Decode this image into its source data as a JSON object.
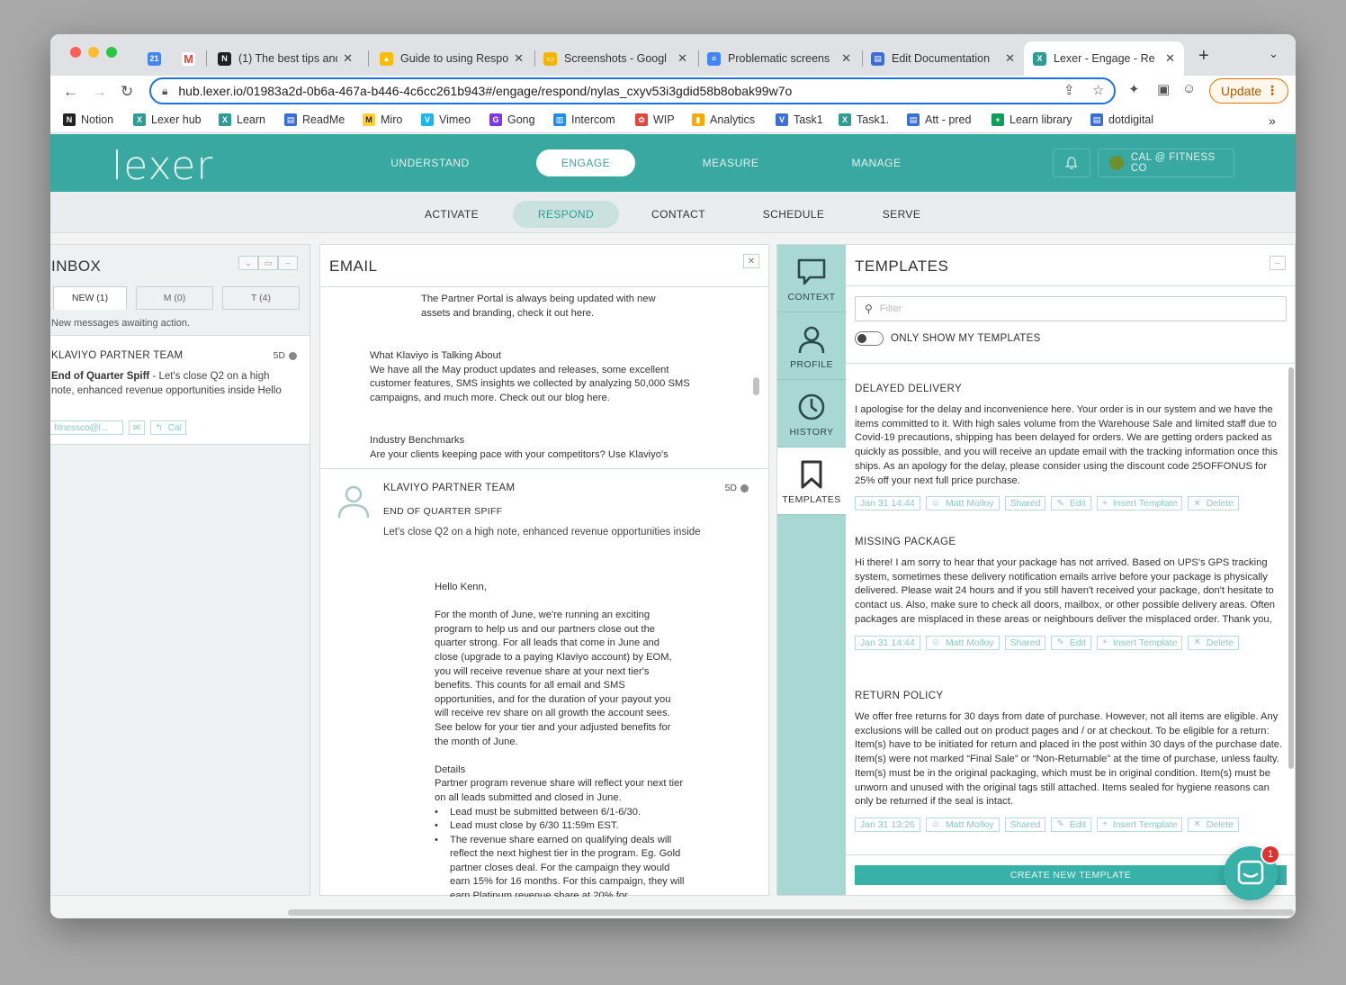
{
  "browser": {
    "tabs": [
      {
        "title": "",
        "icon": "calendar-icon",
        "color": "#4285f4"
      },
      {
        "title": "",
        "icon": "gmail-icon",
        "color": "#ea4335"
      },
      {
        "title": "(1) The best tips and",
        "icon": "notion-icon",
        "color": "#222222"
      },
      {
        "title": "Guide to using Respo",
        "icon": "drive-icon",
        "color": "#fbbc04"
      },
      {
        "title": "Screenshots - Googl",
        "icon": "slides-icon",
        "color": "#f4b400"
      },
      {
        "title": "Problematic screens",
        "icon": "docs-icon",
        "color": "#4285f4"
      },
      {
        "title": "Edit Documentation",
        "icon": "readme-icon",
        "color": "#3b6fd4"
      },
      {
        "title": "Lexer - Engage - Re",
        "icon": "lexer-icon",
        "color": "#2d9c94"
      }
    ],
    "url": "hub.lexer.io/01983a2d-0b6a-467a-b446-4c6cc261b943#/engage/respond/nylas_cxyv53i3gdid58b8obak99w7o",
    "update_label": "Update",
    "bookmarks": [
      {
        "label": "Notion",
        "color": "#222222"
      },
      {
        "label": "Lexer hub",
        "color": "#2d9c94"
      },
      {
        "label": "Learn",
        "color": "#2d9c94"
      },
      {
        "label": "ReadMe",
        "color": "#3b6fd4"
      },
      {
        "label": "Miro",
        "color": "#ffd02f"
      },
      {
        "label": "Vimeo",
        "color": "#1ab7ea"
      },
      {
        "label": "Gong",
        "color": "#8039df"
      },
      {
        "label": "Intercom",
        "color": "#1f8ded"
      },
      {
        "label": "WIP",
        "color": "#e0493f"
      },
      {
        "label": "Analytics",
        "color": "#f9ab00"
      },
      {
        "label": "Task1",
        "color": "#3b6fd4"
      },
      {
        "label": "Task1.",
        "color": "#2d9c94"
      },
      {
        "label": "Att - pred",
        "color": "#3b6fd4"
      },
      {
        "label": "Learn library",
        "color": "#0f9d58"
      },
      {
        "label": "dotdigital",
        "color": "#3b6fd4"
      }
    ]
  },
  "app": {
    "logo": "lexer",
    "nav": [
      "UNDERSTAND",
      "ENGAGE",
      "MEASURE",
      "MANAGE"
    ],
    "account": "CAL @ FITNESS CO",
    "subnav": [
      "ACTIVATE",
      "RESPOND",
      "CONTACT",
      "SCHEDULE",
      "SERVE"
    ]
  },
  "inbox": {
    "title": "INBOX",
    "tabs": [
      "NEW (1)",
      "M (0)",
      "T (4)"
    ],
    "note": "New messages awaiting action.",
    "item": {
      "sender": "KLAVIYO PARTNER TEAM",
      "age": "5D",
      "subject": "End of Quarter Spiff",
      "preview": " - Let's close Q2 on a high note, enhanced revenue opportunities inside Hello",
      "chips": [
        "fitnessco@l...",
        "",
        "Cal"
      ]
    }
  },
  "email": {
    "title": "EMAIL",
    "top_blocks": [
      "The Partner Portal is always being updated with new assets and branding, check it out here.",
      "What Klaviyo is Talking About\nWe have all the May product updates and releases, some excellent customer features, SMS insights we collected by analyzing 50,000 SMS campaigns, and much more. Check out our blog here.",
      "Industry Benchmarks\nAre your clients keeping pace with your competitors? Use Klaviyo's"
    ],
    "message": {
      "from": "KLAVIYO PARTNER TEAM",
      "age": "5D",
      "subject": "END OF QUARTER SPIFF",
      "snippet": "Let's close Q2 on a high note, enhanced revenue opportunities inside",
      "greeting": "Hello Kenn,",
      "para1": "For the month of June, we're running an exciting program to help us and our partners close out the quarter strong. For all leads that come in June and close (upgrade to a paying Klaviyo account) by EOM, you will receive revenue share at your next tier's benefits. This counts for all email and SMS opportunities, and for the duration of your payout you will receive rev share on all growth the account sees. See below for your tier and your adjusted benefits for the month of June.",
      "details_heading": "Details",
      "details_intro": "Partner program revenue share will reflect your next tier on all leads submitted and closed in June.",
      "bullets": [
        "Lead must be submitted between 6/1-6/30.",
        "Lead must close by 6/30 11:59m EST.",
        "The revenue share earned on qualifying deals will reflect the next highest tier in the program. Eg. Gold partner closes deal. For the campaign they would earn 15% for 16 months. For this campaign, they will earn Platinum revenue share at 20% for"
      ]
    }
  },
  "sidebar": {
    "items": [
      {
        "label": "CONTEXT",
        "icon": "chat-bubble-icon"
      },
      {
        "label": "PROFILE",
        "icon": "person-icon"
      },
      {
        "label": "HISTORY",
        "icon": "clock-icon"
      },
      {
        "label": "TEMPLATES",
        "icon": "bookmark-icon"
      }
    ]
  },
  "templates": {
    "title": "TEMPLATES",
    "filter_placeholder": "Filter",
    "toggle_label": "ONLY SHOW MY TEMPLATES",
    "items": [
      {
        "name": "DELAYED DELIVERY",
        "body": "I apologise for the delay and inconvenience here. Your order is in our system and we have the items committed to it. With high sales volume from the Warehouse Sale and limited staff due to Covid-19 precautions, shipping has been delayed for orders. We are getting orders packed as quickly as possible, and you will receive an update email with the tracking information once this ships. As an apology for the delay, please consider using the discount code 25OFFONUS for 25% off your next full price purchase.",
        "date": "Jan 31 14:44",
        "author": "Matt Molloy",
        "shared": "Shared"
      },
      {
        "name": "MISSING PACKAGE",
        "body": "Hi there! I am sorry to hear that your package has not arrived. Based on UPS's GPS tracking system, sometimes these delivery notification emails arrive before your package is physically delivered. Please wait 24 hours and if you still haven't received your package, don't hesitate to contact us. Also, make sure to check all doors, mailbox, or other possible delivery areas. Often packages are misplaced in these areas or neighbours deliver the misplaced order. Thank you,",
        "date": "Jan 31 14:44",
        "author": "Matt Molloy",
        "shared": "Shared"
      },
      {
        "name": "RETURN POLICY",
        "body": "We offer free returns for 30 days from date of purchase. However, not all items are eligible. Any exclusions will be called out on product pages and / or at checkout. To be eligible for a return: Item(s) have to be initiated for return and placed in the post within 30 days of the purchase date. Item(s) were not marked “Final Sale” or “Non-Returnable” at the time of purchase, unless faulty. Item(s) must be in the original packaging, which must be in original condition. Item(s) must be unworn and unused with the original tags still attached. Items sealed for hygiene reasons can only be returned if the seal is intact.",
        "date": "Jan 31 13:26",
        "author": "Matt Molloy",
        "shared": "Shared"
      }
    ],
    "edit_label": "Edit",
    "insert_label": "Insert Template",
    "delete_label": "Delete",
    "create_label": "CREATE NEW TEMPLATE"
  },
  "chat": {
    "badge": "1"
  },
  "colors": {
    "brand": "#38a8a0",
    "accent": "#38b2a8",
    "sidebar": "#a9d8d4"
  }
}
